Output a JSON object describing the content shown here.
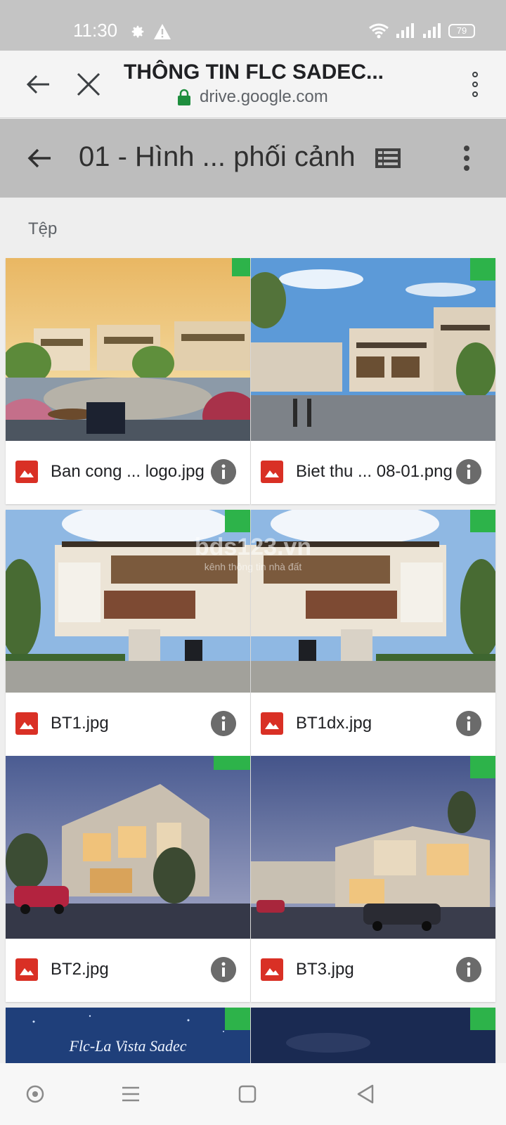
{
  "status_bar": {
    "time": "11:30",
    "battery": "79",
    "icons": [
      "gear-icon",
      "warning-icon",
      "wifi-icon",
      "signal-icon",
      "signal-icon",
      "battery-icon"
    ]
  },
  "browser_bar": {
    "title": "THÔNG TIN FLC SADEC...",
    "url": "drive.google.com",
    "lock_color": "#1e8e3e"
  },
  "drive_header": {
    "title": "01 - Hình ... phối cảnh"
  },
  "section": {
    "label": "Tệp"
  },
  "files": [
    {
      "name": "Ban cong ... logo.jpg"
    },
    {
      "name": "Biet thu ... 08-01.png"
    },
    {
      "name": "BT1.jpg"
    },
    {
      "name": "BT1dx.jpg"
    },
    {
      "name": "BT2.jpg"
    },
    {
      "name": "BT3.jpg"
    },
    {
      "name": ""
    },
    {
      "name": ""
    }
  ],
  "watermark": {
    "brand": "bds123.vn",
    "tagline": "kênh thông tin nhà đất"
  },
  "thumbnail_text": {
    "flc": "Flc-La Vista Sadec"
  },
  "colors": {
    "image_icon": "#d93025",
    "badge_green": "#2db34a",
    "info_button": "#6b6b6b"
  }
}
